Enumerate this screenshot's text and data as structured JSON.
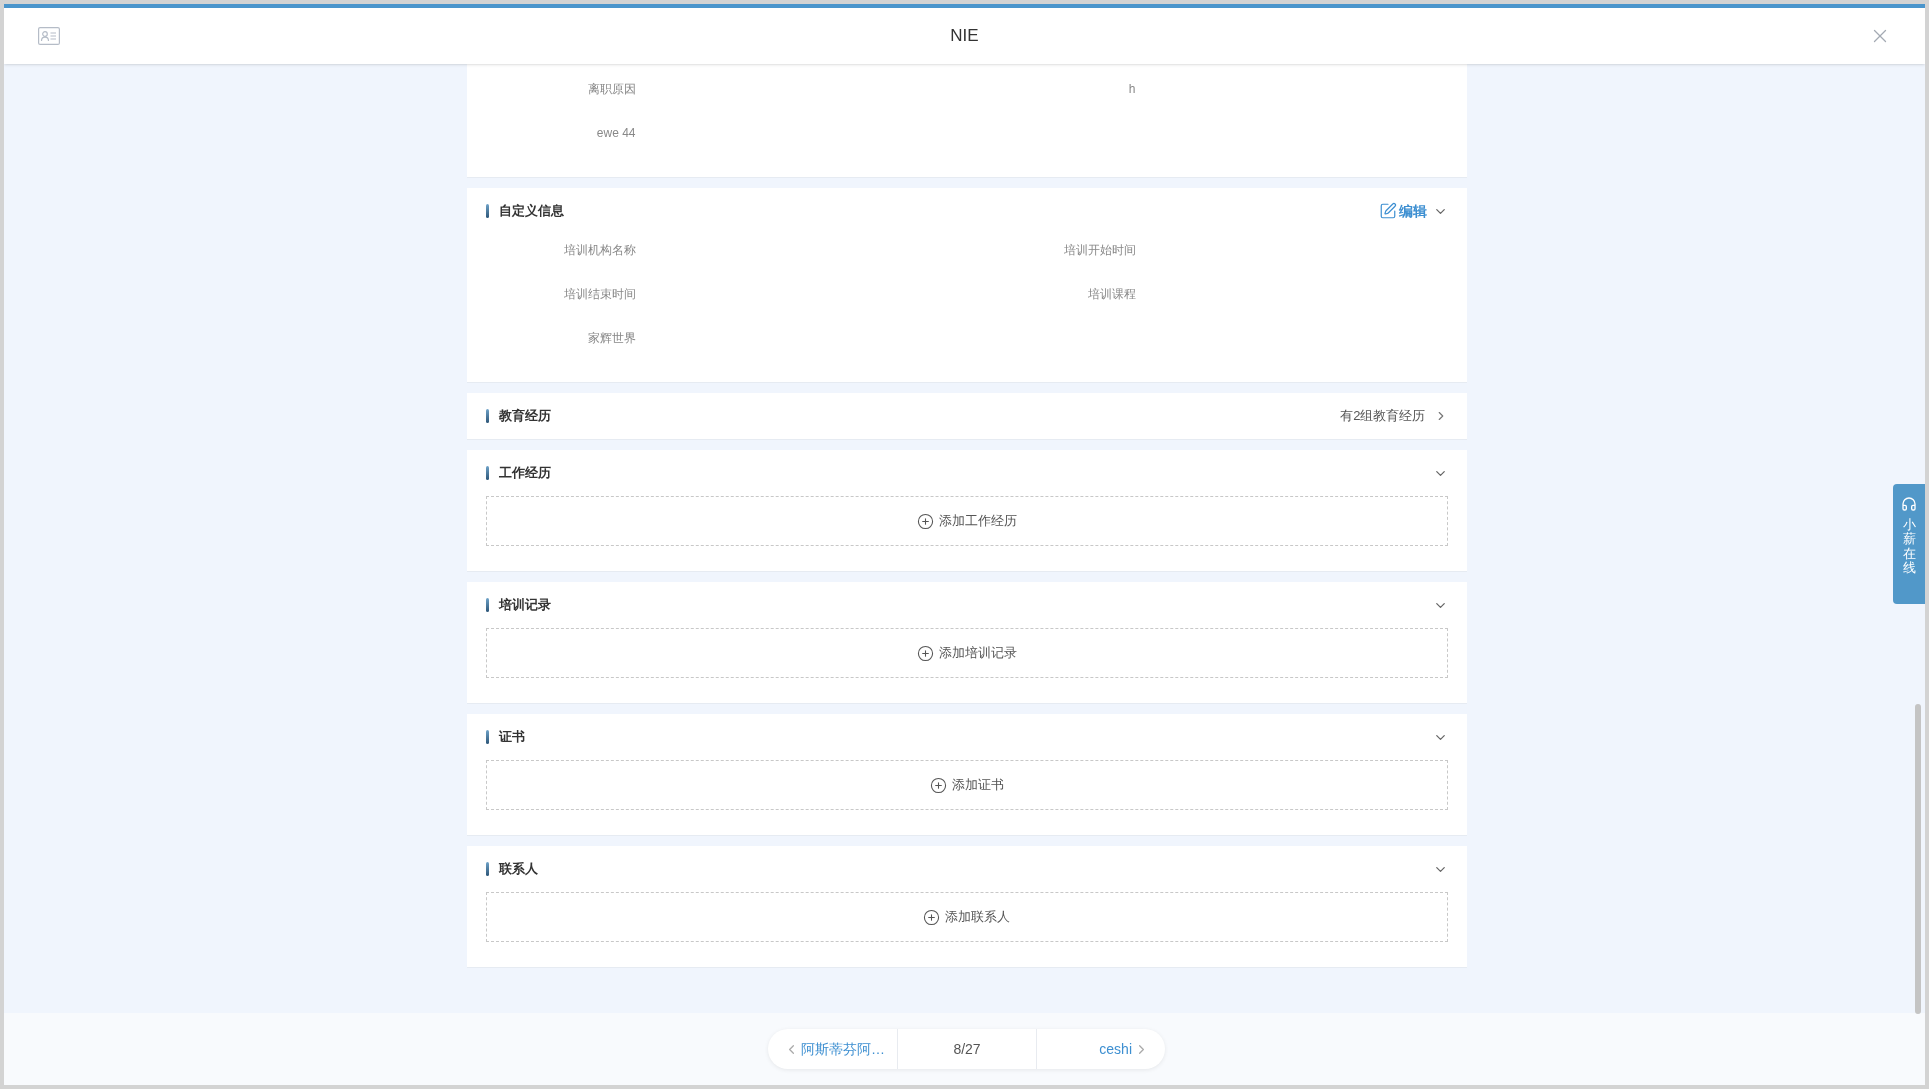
{
  "window": {
    "title": "NIE"
  },
  "sections": [
    {
      "kind": "fields",
      "fields": [
        "离职原因",
        "h",
        "ewe 44"
      ]
    },
    {
      "kind": "fields",
      "title": "自定义信息",
      "action": "编辑",
      "expanded": true,
      "fields": [
        "培训机构名称",
        "培训开始时间",
        "培训结束时间",
        "培训课程",
        "家辉世界"
      ]
    },
    {
      "kind": "link",
      "title": "教育经历",
      "summary": "有2组教育经历"
    },
    {
      "kind": "add",
      "title": "工作经历",
      "expanded": true,
      "add_label": "添加工作经历"
    },
    {
      "kind": "add",
      "title": "培训记录",
      "expanded": true,
      "add_label": "添加培训记录"
    },
    {
      "kind": "add",
      "title": "证书",
      "expanded": true,
      "add_label": "添加证书"
    },
    {
      "kind": "add",
      "title": "联系人",
      "expanded": true,
      "add_label": "添加联系人"
    }
  ],
  "support_tab": "小薪在线",
  "pager": {
    "previous": "阿斯蒂芬阿…",
    "position": "8/27",
    "next": "ceshi"
  }
}
